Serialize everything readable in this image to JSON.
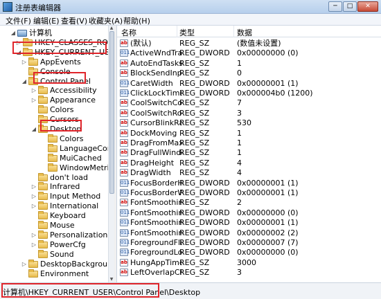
{
  "window": {
    "title": "注册表编辑器",
    "minimize": "─",
    "maximize": "□",
    "close": "✕"
  },
  "menu": [
    "文件(F)",
    "编辑(E)",
    "查看(V)",
    "收藏夹(A)",
    "帮助(H)"
  ],
  "tree": [
    {
      "label": "计算机",
      "level": 0,
      "arrow": "◢",
      "kind": "computer"
    },
    {
      "label": "HKEY_CLASSES_ROOT",
      "level": 1,
      "arrow": "▷"
    },
    {
      "label": "HKEY_CURRENT_USER",
      "level": 1,
      "arrow": "◢"
    },
    {
      "label": "AppEvents",
      "level": 2,
      "arrow": "▷"
    },
    {
      "label": "Console",
      "level": 2,
      "arrow": ""
    },
    {
      "label": "Control Panel",
      "level": 2,
      "arrow": "◢"
    },
    {
      "label": "Accessibility",
      "level": 3,
      "arrow": "▷"
    },
    {
      "label": "Appearance",
      "level": 3,
      "arrow": "▷"
    },
    {
      "label": "Colors",
      "level": 3,
      "arrow": ""
    },
    {
      "label": "Cursors",
      "level": 3,
      "arrow": ""
    },
    {
      "label": "Desktop",
      "level": 3,
      "arrow": "◢"
    },
    {
      "label": "Colors",
      "level": 4,
      "arrow": ""
    },
    {
      "label": "LanguageConfig",
      "level": 4,
      "arrow": ""
    },
    {
      "label": "MuiCached",
      "level": 4,
      "arrow": ""
    },
    {
      "label": "WindowMetrics",
      "level": 4,
      "arrow": ""
    },
    {
      "label": "don't load",
      "level": 3,
      "arrow": ""
    },
    {
      "label": "Infrared",
      "level": 3,
      "arrow": "▷"
    },
    {
      "label": "Input Method",
      "level": 3,
      "arrow": "▷"
    },
    {
      "label": "International",
      "level": 3,
      "arrow": "▷"
    },
    {
      "label": "Keyboard",
      "level": 3,
      "arrow": ""
    },
    {
      "label": "Mouse",
      "level": 3,
      "arrow": ""
    },
    {
      "label": "Personalization",
      "level": 3,
      "arrow": "▷"
    },
    {
      "label": "PowerCfg",
      "level": 3,
      "arrow": "▷"
    },
    {
      "label": "Sound",
      "level": 3,
      "arrow": ""
    },
    {
      "label": "DesktopBackground",
      "level": 2,
      "arrow": "▷"
    },
    {
      "label": "Environment",
      "level": 2,
      "arrow": ""
    }
  ],
  "columns": {
    "name": "名称",
    "type": "类型",
    "data": "数据"
  },
  "values": [
    {
      "name": "(默认)",
      "type": "REG_SZ",
      "data": "(数值未设置)",
      "icon": "sz"
    },
    {
      "name": "ActiveWndTrac...",
      "type": "REG_DWORD",
      "data": "0x00000000 (0)",
      "icon": "dw"
    },
    {
      "name": "AutoEndTasks",
      "type": "REG_SZ",
      "data": "1",
      "icon": "sz"
    },
    {
      "name": "BlockSendInpu...",
      "type": "REG_SZ",
      "data": "0",
      "icon": "sz"
    },
    {
      "name": "CaretWidth",
      "type": "REG_DWORD",
      "data": "0x00000001 (1)",
      "icon": "dw"
    },
    {
      "name": "ClickLockTime",
      "type": "REG_DWORD",
      "data": "0x000004b0 (1200)",
      "icon": "dw"
    },
    {
      "name": "CoolSwitchCol...",
      "type": "REG_SZ",
      "data": "7",
      "icon": "sz"
    },
    {
      "name": "CoolSwitchRows",
      "type": "REG_SZ",
      "data": "3",
      "icon": "sz"
    },
    {
      "name": "CursorBlinkRate",
      "type": "REG_SZ",
      "data": "530",
      "icon": "sz"
    },
    {
      "name": "DockMoving",
      "type": "REG_SZ",
      "data": "1",
      "icon": "sz"
    },
    {
      "name": "DragFromMaxi...",
      "type": "REG_SZ",
      "data": "1",
      "icon": "sz"
    },
    {
      "name": "DragFullWindo...",
      "type": "REG_SZ",
      "data": "1",
      "icon": "sz"
    },
    {
      "name": "DragHeight",
      "type": "REG_SZ",
      "data": "4",
      "icon": "sz"
    },
    {
      "name": "DragWidth",
      "type": "REG_SZ",
      "data": "4",
      "icon": "sz"
    },
    {
      "name": "FocusBorderH...",
      "type": "REG_DWORD",
      "data": "0x00000001 (1)",
      "icon": "dw"
    },
    {
      "name": "FocusBorderW...",
      "type": "REG_DWORD",
      "data": "0x00000001 (1)",
      "icon": "dw"
    },
    {
      "name": "FontSmoothing",
      "type": "REG_SZ",
      "data": "2",
      "icon": "sz"
    },
    {
      "name": "FontSmoothin...",
      "type": "REG_DWORD",
      "data": "0x00000000 (0)",
      "icon": "dw"
    },
    {
      "name": "FontSmoothin...",
      "type": "REG_DWORD",
      "data": "0x00000001 (1)",
      "icon": "dw"
    },
    {
      "name": "FontSmoothin...",
      "type": "REG_DWORD",
      "data": "0x00000002 (2)",
      "icon": "dw"
    },
    {
      "name": "ForegroundFla...",
      "type": "REG_DWORD",
      "data": "0x00000007 (7)",
      "icon": "dw"
    },
    {
      "name": "ForegroundLo...",
      "type": "REG_DWORD",
      "data": "0x00000000 (0)",
      "icon": "dw"
    },
    {
      "name": "HungAppTime...",
      "type": "REG_SZ",
      "data": "3000",
      "icon": "sz"
    },
    {
      "name": "LeftOverlapCh...",
      "type": "REG_SZ",
      "data": "3",
      "icon": "sz"
    }
  ],
  "status": {
    "path": "计算机\\HKEY_CURRENT_USER\\Control Panel\\Desktop"
  },
  "colors": {
    "highlight": "#e0242a",
    "titlebar": "#cfe0f3"
  }
}
